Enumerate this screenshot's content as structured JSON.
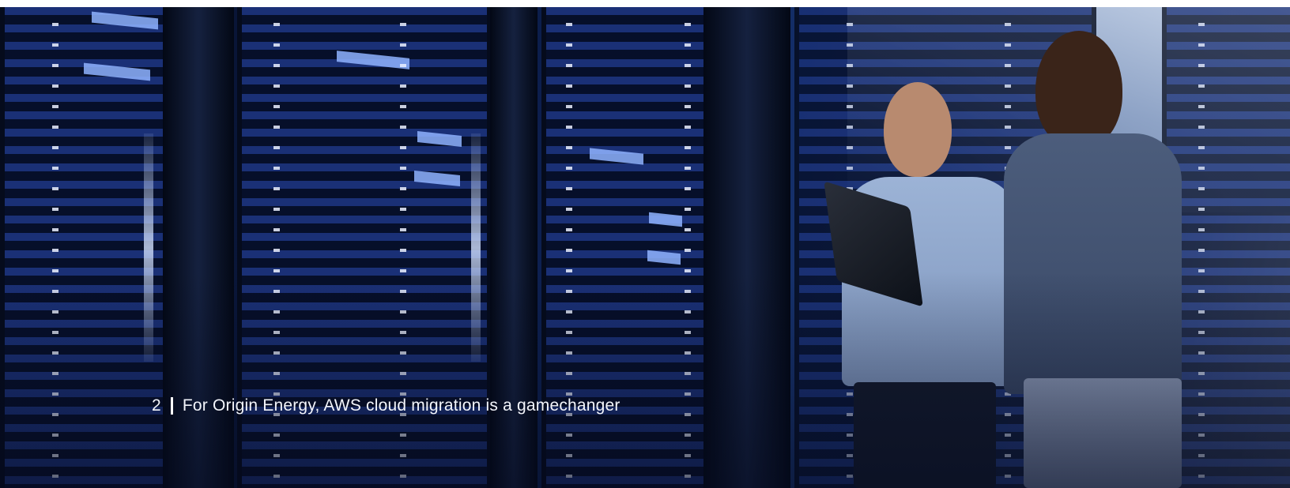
{
  "hero": {
    "image_description_icon": "data-center-photo",
    "caption": {
      "number": "2",
      "text": "For Origin Energy, AWS cloud migration is a gamechanger"
    }
  },
  "colors": {
    "caption_text": "#f3f5fb",
    "background_dark": "#07102a",
    "rack_blue": "#2846aa"
  }
}
